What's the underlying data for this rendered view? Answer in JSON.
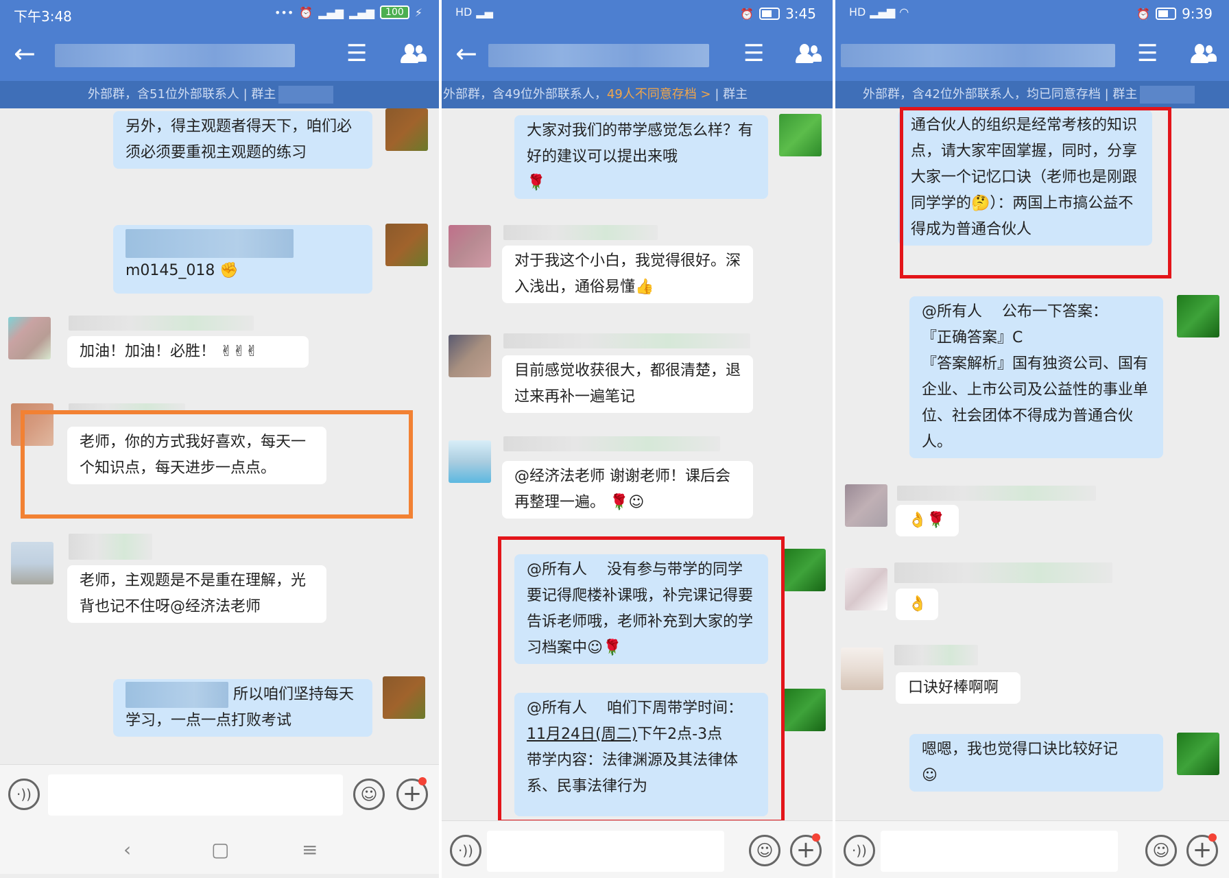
{
  "colors": {
    "accent": "#4d7fd0",
    "subbar": "#3f6fb8",
    "mine_bubble": "#cfe6fb",
    "highlight_red": "#e3151a",
    "highlight_orange": "#f28133"
  },
  "panel1": {
    "status": {
      "time": "下午3:48",
      "battery": "100"
    },
    "subbar": {
      "text": "外部群，含51位外部联系人 | 群主"
    },
    "messages": {
      "m1": "另外，得主观题者得天下，咱们必须必须要重视主观题的练习",
      "m2": "m0145_018",
      "m3": "加油！加油！必胜！",
      "m4": "老师，你的方式我好喜欢，每天一个知识点，每天进步一点点。",
      "m5": "老师，主观题是不是重在理解，光背也记不住呀@经济法老师",
      "m6": "所以咱们坚持每天学习，一点一点打败考试"
    }
  },
  "panel2": {
    "status": {
      "time": "3:45"
    },
    "subbar": {
      "text": "外部群，含49位外部联系人，",
      "warn": "49人不同意存档 >",
      "suffix": " | 群主"
    },
    "messages": {
      "m1": "大家对我们的带学感觉怎么样？有好的建议可以提出来哦",
      "m2": "对于我这个小白，我觉得很好。深入浅出，通俗易懂",
      "m3": "目前感觉收获很大，都很清楚，退过来再补一遍笔记",
      "m4": "@经济法老师 谢谢老师！课后会再整理一遍。",
      "m5": "@所有人　 没有参与带学的同学要记得爬楼补课哦，补完课记得要告诉老师哦，老师补充到大家的学习档案中",
      "m6_line1": "@所有人　 咱们下周带学时间：",
      "m6_date": "11月24日(周二)",
      "m6_line2": "下午2点-3点",
      "m6_line3": "带学内容：法律渊源及其法律体系、民事法律行为"
    }
  },
  "panel3": {
    "status": {
      "time": "9:39"
    },
    "subbar": {
      "text": "外部群，含42位外部联系人，均已同意存档 | 群主"
    },
    "messages": {
      "m1a": "通合伙人的组织是经常考核的知识点，请大家牢固掌握，同时，分享大家一个记忆口诀（老师也是刚跟同学学的",
      "m1b": "）：两国上市搞公益不得成为普通合伙人",
      "m2a": "@所有人　 公布一下答案：",
      "m2b": "『正确答案』C",
      "m2c": "『答案解析』国有独资公司、国有企业、上市公司及公益性的事业单位、社会团体不得成为普通合伙人。",
      "m5": "口诀好棒啊啊",
      "m6": "嗯嗯，我也觉得口诀比较好记"
    }
  }
}
